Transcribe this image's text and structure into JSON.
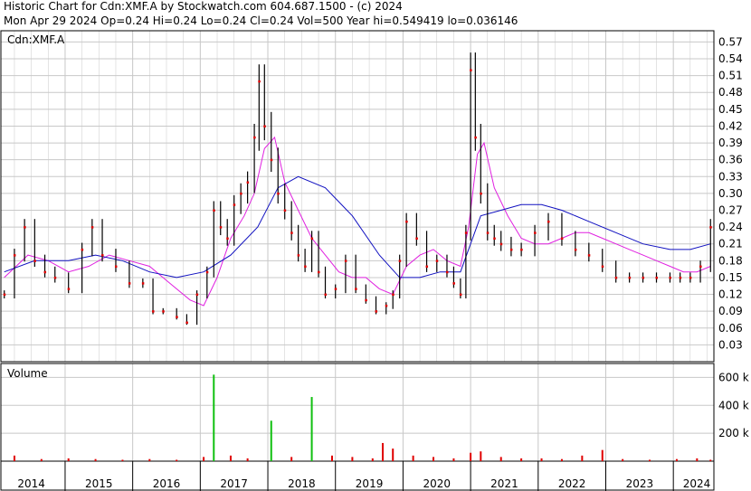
{
  "header": {
    "line1": "Historic Chart for Cdn:XMF.A by Stockwatch.com 604.687.1500 - (c) 2024",
    "line2": "Mon Apr 29 2024  Op=0.24  Hi=0.24  Lo=0.24  Cl=0.24  Vol=500  Year hi=0.549419  lo=0.036146"
  },
  "price_panel_label": "Cdn:XMF.A",
  "volume_panel_label": "Volume",
  "colors": {
    "bar": "#000000",
    "dot": "#e00000",
    "ma_fast": "#e020e0",
    "ma_slow": "#1010c0",
    "vol_red": "#e00000",
    "vol_green": "#10c010",
    "vol_gray": "#a0a0a0",
    "grid": "#c8c8c8"
  },
  "chart_data": [
    {
      "type": "line",
      "title": "Cdn:XMF.A",
      "ylim": [
        0.0,
        0.59
      ],
      "ytick_labels": [
        "0.57",
        "0.54",
        "0.51",
        "0.48",
        "0.45",
        "0.42",
        "0.39",
        "0.36",
        "0.33",
        "0.30",
        "0.27",
        "0.24",
        "0.21",
        "0.18",
        "0.15",
        "0.12",
        "0.09",
        "0.06",
        "0.03"
      ],
      "xtick_labels": [
        "2014",
        "2015",
        "2016",
        "2017",
        "2018",
        "2019",
        "2020",
        "2021",
        "2022",
        "2023",
        "2024"
      ],
      "x_year_start": 2013.8,
      "x_year_end": 2024.35,
      "series": [
        {
          "role": "price",
          "x": [
            2013.85,
            2014.0,
            2014.15,
            2014.3,
            2014.45,
            2014.6,
            2014.8,
            2015.0,
            2015.15,
            2015.3,
            2015.5,
            2015.7,
            2015.9,
            2016.05,
            2016.2,
            2016.4,
            2016.55,
            2016.7,
            2016.85,
            2016.95,
            2017.05,
            2017.15,
            2017.25,
            2017.35,
            2017.45,
            2017.55,
            2017.62,
            2017.7,
            2017.8,
            2017.9,
            2018.0,
            2018.1,
            2018.2,
            2018.3,
            2018.4,
            2018.5,
            2018.6,
            2018.75,
            2018.9,
            2019.05,
            2019.2,
            2019.35,
            2019.5,
            2019.6,
            2019.7,
            2019.8,
            2019.95,
            2020.1,
            2020.25,
            2020.4,
            2020.5,
            2020.6,
            2020.68,
            2020.75,
            2020.82,
            2020.9,
            2021.0,
            2021.1,
            2021.2,
            2021.35,
            2021.5,
            2021.7,
            2021.9,
            2022.1,
            2022.3,
            2022.5,
            2022.7,
            2022.9,
            2023.1,
            2023.3,
            2023.5,
            2023.7,
            2023.85,
            2024.0,
            2024.15,
            2024.3
          ],
          "y": [
            0.12,
            0.19,
            0.24,
            0.18,
            0.16,
            0.15,
            0.13,
            0.2,
            0.24,
            0.19,
            0.17,
            0.14,
            0.14,
            0.09,
            0.09,
            0.08,
            0.07,
            0.12,
            0.16,
            0.27,
            0.24,
            0.22,
            0.28,
            0.3,
            0.32,
            0.4,
            0.5,
            0.42,
            0.36,
            0.3,
            0.27,
            0.23,
            0.19,
            0.17,
            0.22,
            0.16,
            0.12,
            0.13,
            0.18,
            0.13,
            0.11,
            0.09,
            0.1,
            0.12,
            0.18,
            0.25,
            0.22,
            0.17,
            0.18,
            0.16,
            0.14,
            0.12,
            0.23,
            0.52,
            0.4,
            0.3,
            0.23,
            0.22,
            0.21,
            0.2,
            0.2,
            0.23,
            0.25,
            0.22,
            0.2,
            0.19,
            0.17,
            0.15,
            0.15,
            0.15,
            0.15,
            0.15,
            0.15,
            0.15,
            0.17,
            0.24
          ]
        },
        {
          "role": "moving-average-fast",
          "x": [
            2013.85,
            2014.2,
            2014.5,
            2014.8,
            2015.1,
            2015.4,
            2015.7,
            2016.0,
            2016.3,
            2016.6,
            2016.8,
            2017.0,
            2017.2,
            2017.4,
            2017.55,
            2017.7,
            2017.85,
            2018.0,
            2018.2,
            2018.4,
            2018.6,
            2018.8,
            2019.0,
            2019.2,
            2019.4,
            2019.6,
            2019.8,
            2020.0,
            2020.2,
            2020.4,
            2020.6,
            2020.72,
            2020.85,
            2020.95,
            2021.1,
            2021.3,
            2021.5,
            2021.7,
            2021.9,
            2022.1,
            2022.3,
            2022.5,
            2022.7,
            2022.9,
            2023.1,
            2023.3,
            2023.5,
            2023.7,
            2023.9,
            2024.1,
            2024.3
          ],
          "y": [
            0.15,
            0.19,
            0.18,
            0.16,
            0.17,
            0.19,
            0.18,
            0.17,
            0.14,
            0.11,
            0.1,
            0.15,
            0.22,
            0.26,
            0.3,
            0.38,
            0.4,
            0.32,
            0.27,
            0.22,
            0.19,
            0.16,
            0.15,
            0.15,
            0.13,
            0.12,
            0.17,
            0.19,
            0.2,
            0.18,
            0.17,
            0.24,
            0.37,
            0.39,
            0.31,
            0.26,
            0.22,
            0.21,
            0.21,
            0.22,
            0.23,
            0.23,
            0.22,
            0.21,
            0.2,
            0.19,
            0.18,
            0.17,
            0.16,
            0.16,
            0.17
          ]
        },
        {
          "role": "moving-average-slow",
          "x": [
            2013.85,
            2014.3,
            2014.8,
            2015.2,
            2015.6,
            2016.0,
            2016.4,
            2016.8,
            2017.2,
            2017.6,
            2017.9,
            2018.2,
            2018.6,
            2019.0,
            2019.4,
            2019.7,
            2020.0,
            2020.3,
            2020.6,
            2020.9,
            2021.2,
            2021.5,
            2021.8,
            2022.1,
            2022.5,
            2022.9,
            2023.3,
            2023.7,
            2024.0,
            2024.3
          ],
          "y": [
            0.16,
            0.18,
            0.18,
            0.19,
            0.18,
            0.16,
            0.15,
            0.16,
            0.19,
            0.24,
            0.31,
            0.33,
            0.31,
            0.26,
            0.19,
            0.15,
            0.15,
            0.16,
            0.16,
            0.26,
            0.27,
            0.28,
            0.28,
            0.27,
            0.25,
            0.23,
            0.21,
            0.2,
            0.2,
            0.21
          ]
        }
      ]
    },
    {
      "type": "bar",
      "title": "Volume",
      "ylim": [
        0,
        700000
      ],
      "ytick_labels": [
        "600 k",
        "400 k",
        "200 k"
      ],
      "series": [
        {
          "name": "",
          "x": [
            2014.0,
            2014.4,
            2014.8,
            2015.2,
            2015.6,
            2016.0,
            2016.4,
            2016.8,
            2016.95,
            2017.2,
            2017.45,
            2017.8,
            2018.1,
            2018.4,
            2018.7,
            2019.0,
            2019.3,
            2019.45,
            2019.6,
            2019.9,
            2020.2,
            2020.5,
            2020.75,
            2020.9,
            2021.2,
            2021.5,
            2021.8,
            2022.1,
            2022.4,
            2022.7,
            2023.0,
            2023.4,
            2023.8,
            2024.1,
            2024.3
          ],
          "y": [
            40000,
            15000,
            20000,
            15000,
            10000,
            15000,
            10000,
            30000,
            620000,
            40000,
            20000,
            290000,
            30000,
            460000,
            40000,
            30000,
            20000,
            130000,
            90000,
            40000,
            30000,
            20000,
            60000,
            70000,
            30000,
            20000,
            20000,
            15000,
            40000,
            80000,
            15000,
            10000,
            15000,
            20000,
            10000
          ]
        }
      ]
    }
  ]
}
